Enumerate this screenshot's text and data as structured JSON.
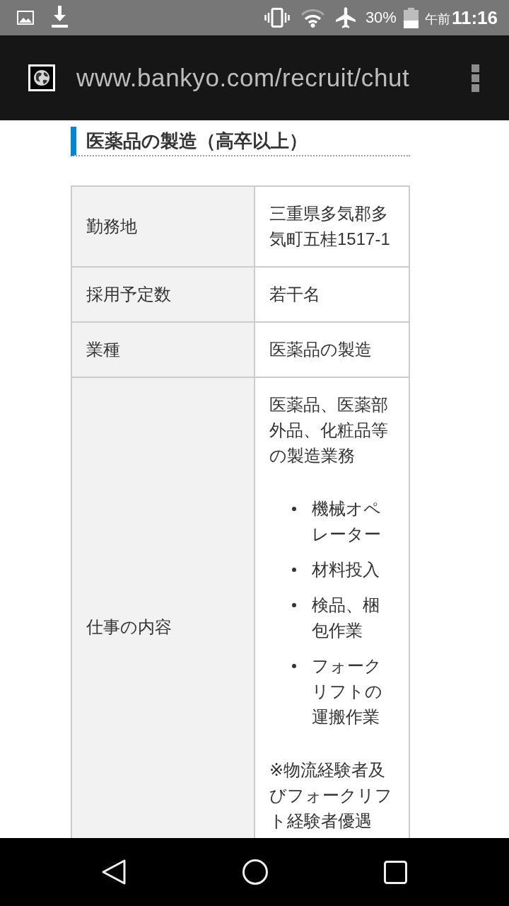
{
  "status_bar": {
    "battery": "30%",
    "clock_period": "午前",
    "clock_time": "11:16"
  },
  "address_bar": {
    "url": "www.bankyo.com/recruit/chut"
  },
  "section": {
    "heading": "医薬品の製造（高卒以上）"
  },
  "table": {
    "rows": [
      {
        "label": "勤務地",
        "value": "三重県多気郡多気町五桂1517-1"
      },
      {
        "label": "採用予定数",
        "value": "若干名"
      },
      {
        "label": "業種",
        "value": "医薬品の製造"
      },
      {
        "label": "仕事の内容",
        "content": [
          {
            "kind": "paragraph",
            "text": "医薬品、医薬部外品、化粧品等の製造業務"
          },
          {
            "kind": "list",
            "items": [
              "機械オペレーター",
              "材料投入",
              "検品、梱包作業",
              "フォークリフトの運搬作業"
            ]
          },
          {
            "kind": "paragraph",
            "text": "※物流経験者及びフォークリフト経験者優遇"
          }
        ]
      }
    ]
  }
}
